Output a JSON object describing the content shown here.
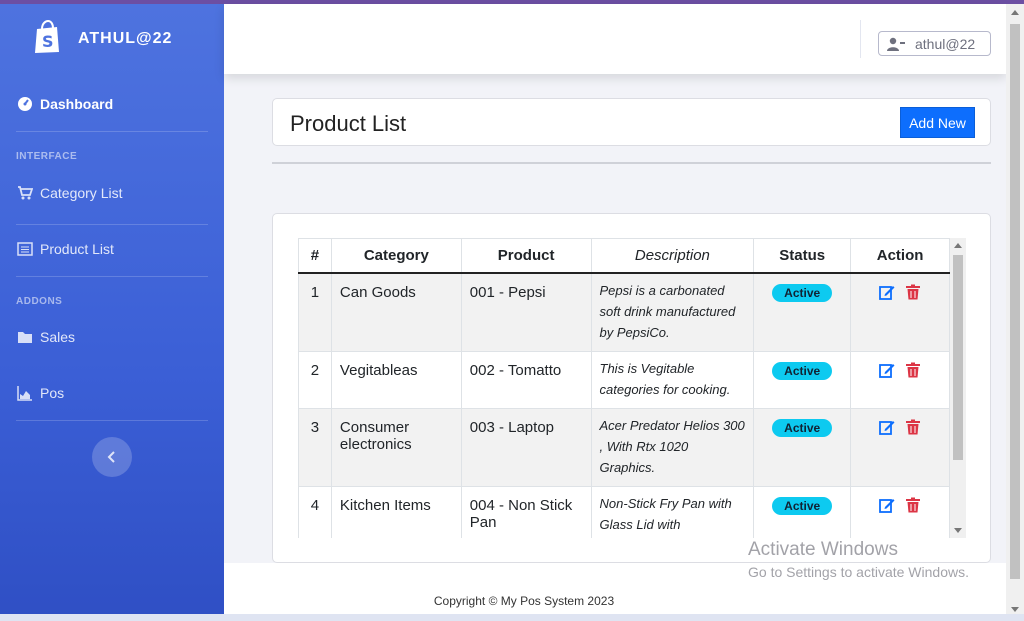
{
  "brand": {
    "name": "ATHUL@22"
  },
  "sidebar": {
    "dashboard": "Dashboard",
    "heading_interface": "INTERFACE",
    "category_list": "Category List",
    "product_list": "Product List",
    "heading_addons": "ADDONS",
    "sales": "Sales",
    "pos": "Pos"
  },
  "header": {
    "username": "athul@22"
  },
  "page": {
    "title": "Product List",
    "add_button": "Add New"
  },
  "table": {
    "headers": {
      "num": "#",
      "category": "Category",
      "product": "Product",
      "description": "Description",
      "status": "Status",
      "action": "Action"
    },
    "rows": [
      {
        "num": "1",
        "category": "Can Goods",
        "product": "001 - Pepsi",
        "description": "Pepsi is a carbonated soft drink manufactured by PepsiCo.",
        "status": "Active"
      },
      {
        "num": "2",
        "category": "Vegitableas",
        "product": "002 - Tomatto",
        "description": "This is Vegitable categories for cooking.",
        "status": "Active"
      },
      {
        "num": "3",
        "category": "Consumer electronics",
        "product": "003 - Laptop",
        "description": "Acer Predator Helios 300 , With Rtx 1020 Graphics.",
        "status": "Active"
      },
      {
        "num": "4",
        "category": "Kitchen Items",
        "product": "004 - Non Stick Pan",
        "description": "Non-Stick Fry Pan with Glass Lid with Detachable Handle",
        "status": "Active"
      }
    ]
  },
  "footer": {
    "copyright": "Copyright © My Pos System 2023"
  },
  "watermark": {
    "line1": "Activate Windows",
    "line2": "Go to Settings to activate Windows."
  },
  "colors": {
    "sidebar": "#4e73df",
    "primary": "#0d6efd",
    "badge": "#0dcaf0",
    "edit": "#0d6efd",
    "delete": "#dc3545"
  }
}
